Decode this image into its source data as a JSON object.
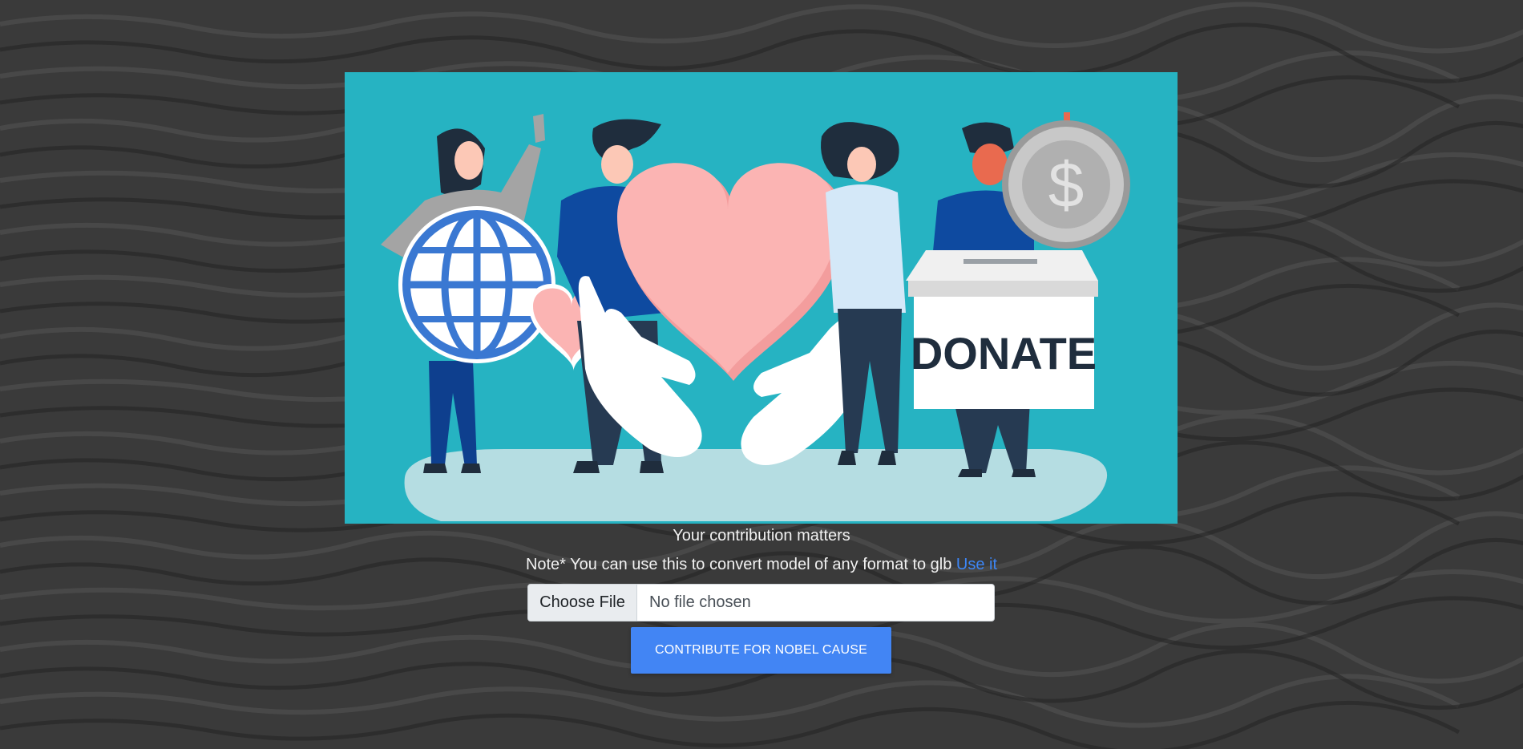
{
  "hero": {
    "alt": "Charity donation illustration",
    "box_label": "DONATE",
    "coin_symbol": "$"
  },
  "caption": "Your contribution matters",
  "note": {
    "text": "Note* You can use this to convert model of any format to glb ",
    "link_text": "Use it"
  },
  "file_input": {
    "button_label": "Choose File",
    "status": "No file chosen"
  },
  "submit": {
    "label": "CONTRIBUTE FOR NOBEL CAUSE"
  },
  "colors": {
    "accent": "#4285f4",
    "link": "#3d86f6",
    "hero_bg": "#26b3c2"
  }
}
